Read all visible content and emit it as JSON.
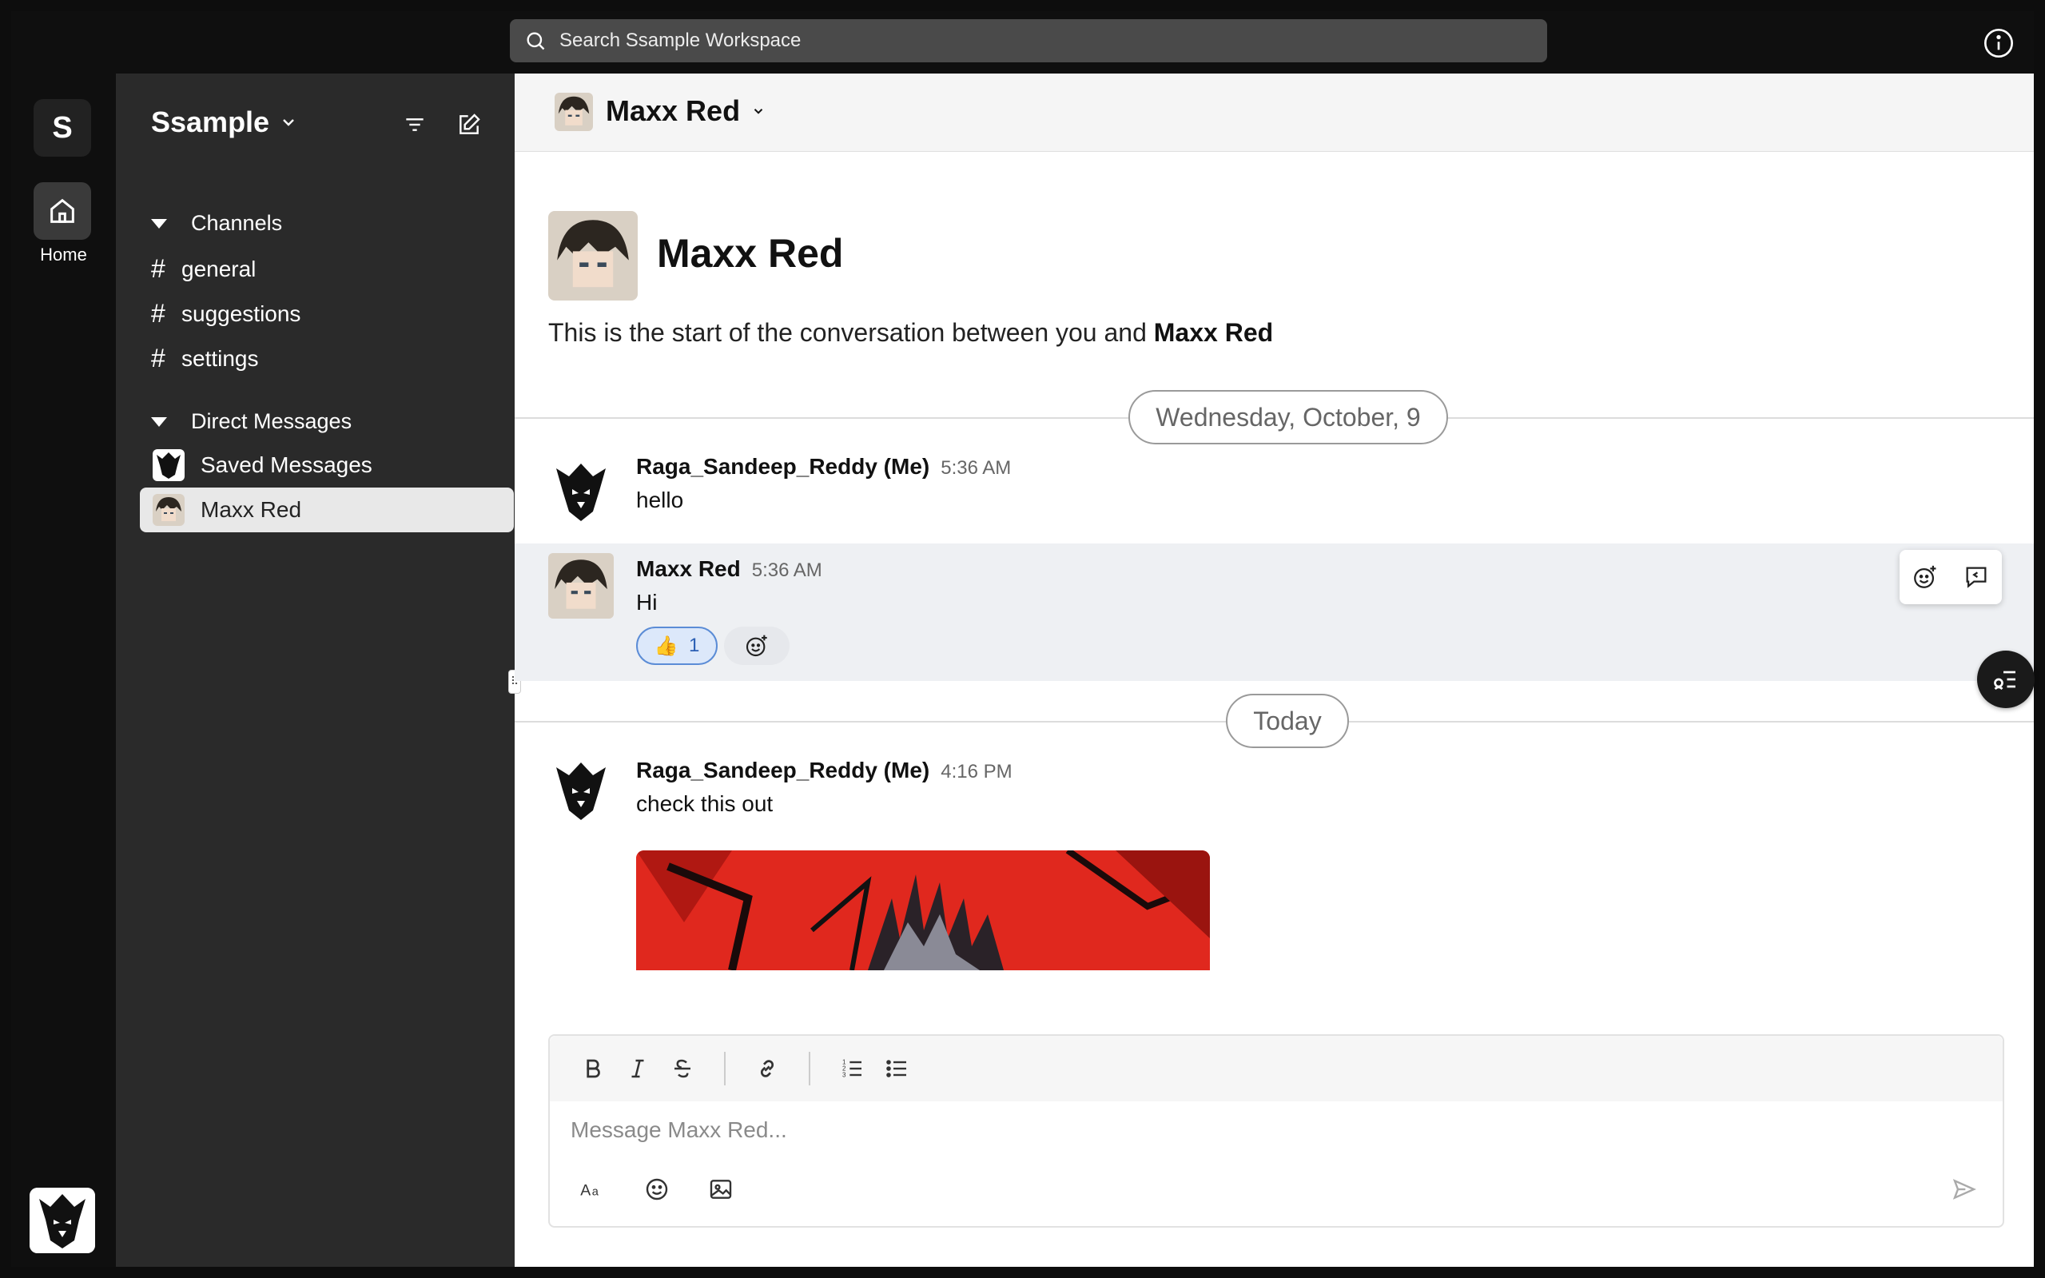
{
  "search": {
    "placeholder": "Search Ssample Workspace"
  },
  "rail": {
    "workspace_initial": "S",
    "home_label": "Home"
  },
  "sidebar": {
    "workspace_name": "Ssample",
    "channels_label": "Channels",
    "channels": [
      "general",
      "suggestions",
      "settings"
    ],
    "dms_label": "Direct Messages",
    "dms": [
      {
        "label": "Saved Messages",
        "active": false
      },
      {
        "label": "Maxx Red",
        "active": true
      }
    ]
  },
  "header": {
    "name": "Maxx Red"
  },
  "intro": {
    "name": "Maxx Red",
    "text_prefix": "This is the start of the conversation between you and ",
    "text_name": "Maxx Red"
  },
  "dates": {
    "first": "Wednesday, October, 9",
    "second": "Today"
  },
  "messages": [
    {
      "author": "Raga_Sandeep_Reddy (Me)",
      "time": "5:36 AM",
      "text": "hello"
    },
    {
      "author": "Maxx Red",
      "time": "5:36 AM",
      "text": "Hi",
      "reaction_emoji": "👍",
      "reaction_count": "1"
    },
    {
      "author": "Raga_Sandeep_Reddy (Me)",
      "time": "4:16 PM",
      "text": "check this out"
    }
  ],
  "composer": {
    "placeholder": "Message Maxx Red..."
  },
  "colors": {
    "accent_reaction": "#5b8cd6",
    "sidebar_bg": "#2a2a2a",
    "attachment_red": "#e0281e"
  }
}
